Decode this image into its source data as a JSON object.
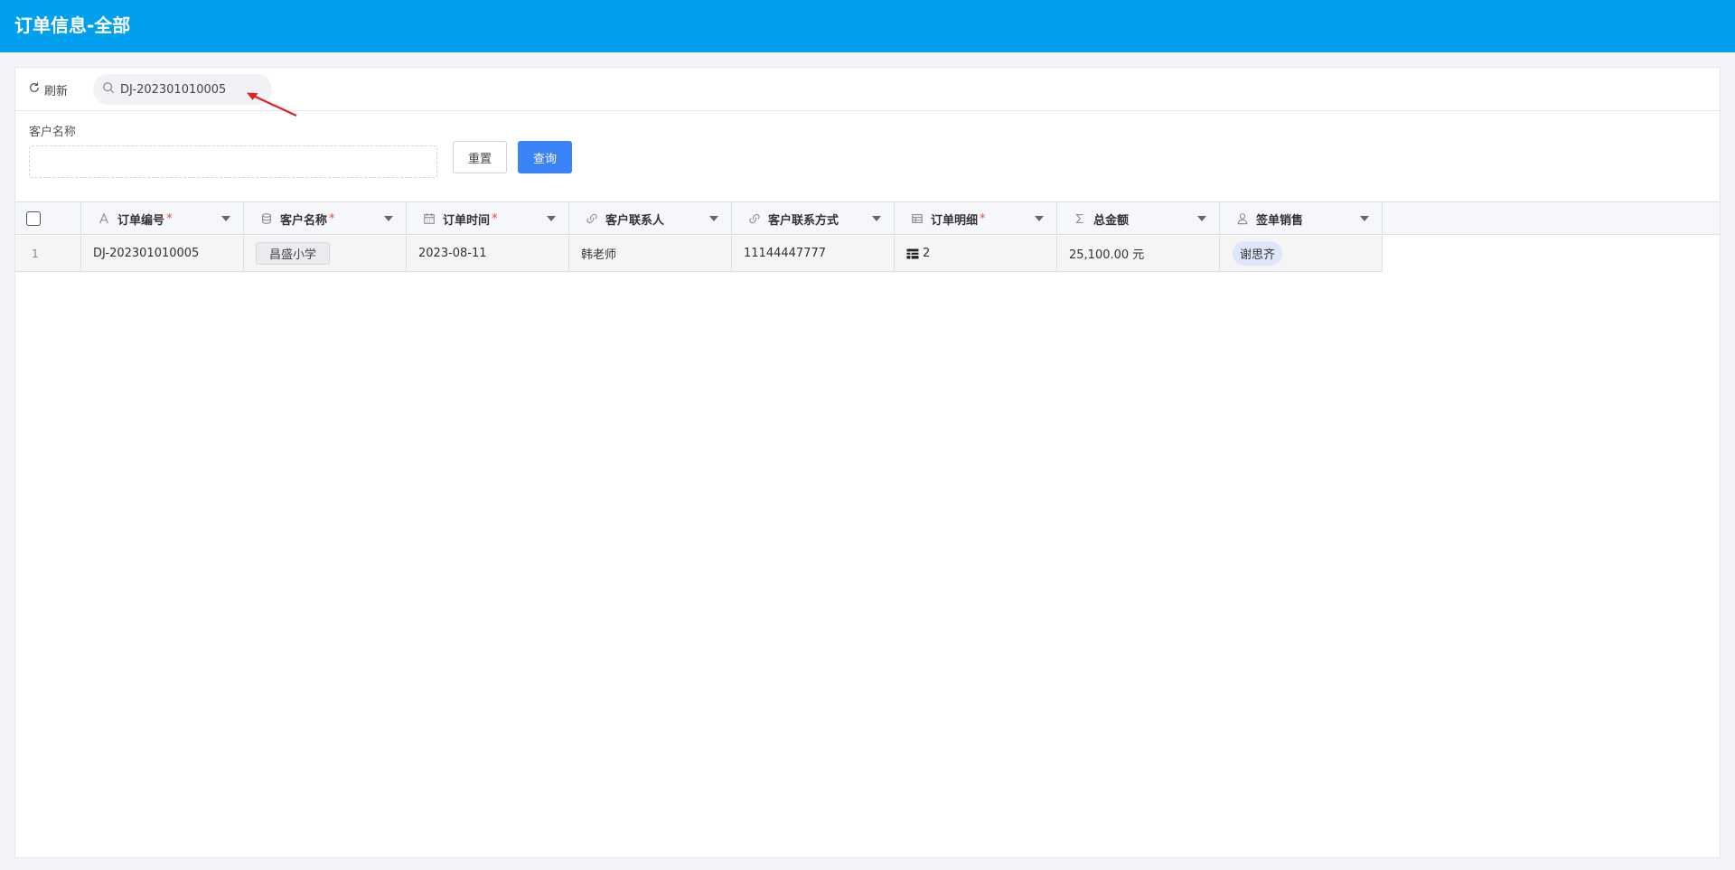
{
  "header": {
    "title": "订单信息-全部"
  },
  "toolbar": {
    "refresh_label": "刷新",
    "search_value": "DJ-202301010005"
  },
  "filter": {
    "field_label": "客户名称",
    "field_value": "",
    "reset_label": "重置",
    "query_label": "查询"
  },
  "table": {
    "columns": [
      {
        "label": "订单编号",
        "icon": "text-icon",
        "required": true,
        "required_mark": "*"
      },
      {
        "label": "客户名称",
        "icon": "database-icon",
        "required": true,
        "required_mark": "*"
      },
      {
        "label": "订单时间",
        "icon": "calendar-icon",
        "required": true,
        "required_mark": "*"
      },
      {
        "label": "客户联系人",
        "icon": "link-icon",
        "required": false
      },
      {
        "label": "客户联系方式",
        "icon": "link-icon",
        "required": false
      },
      {
        "label": "订单明细",
        "icon": "table-icon",
        "required": true,
        "required_mark": "*"
      },
      {
        "label": "总金额",
        "icon": "sigma-icon",
        "required": false
      },
      {
        "label": "签单销售",
        "icon": "user-icon",
        "required": false
      }
    ],
    "rows": [
      {
        "index": "1",
        "order_no": "DJ-202301010005",
        "customer": "昌盛小学",
        "order_date": "2023-08-11",
        "contact": "韩老师",
        "phone": "11144447777",
        "detail_count": "2",
        "total": "25,100.00 元",
        "sales": "谢思齐"
      }
    ]
  },
  "colors": {
    "header_bg": "#00a0ee",
    "primary_button": "#3a82f7",
    "required_mark": "#f0413d",
    "annotation_arrow": "#e02020"
  }
}
